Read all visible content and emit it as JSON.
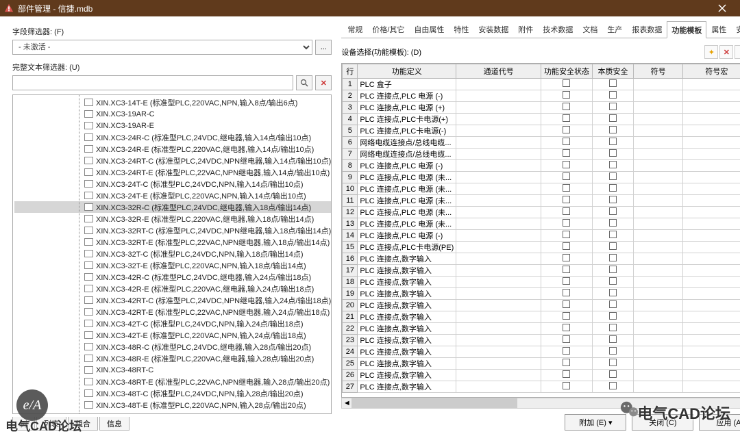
{
  "window": {
    "title": "部件管理 - 信捷.mdb"
  },
  "left": {
    "field_filter_label": "字段筛选器: (F)",
    "field_filter_value": "- 未激活 -",
    "text_filter_label": "完整文本筛选器: (U)",
    "text_filter_value": "",
    "tree_selected": 11,
    "tree_items": [
      "XIN.XC3-14T-E (标准型PLC,220VAC,NPN,输入8点/输出6点)",
      "XIN.XC3-19AR-C",
      "XIN.XC3-19AR-E",
      "XIN.XC3-24R-C (标准型PLC,24VDC,继电器,输入14点/输出10点)",
      "XIN.XC3-24R-E (标准型PLC,220VAC,继电器,输入14点/输出10点)",
      "XIN.XC3-24RT-C (标准型PLC,24VDC,NPN继电器,输入14点/输出10点)",
      "XIN.XC3-24RT-E (标准型PLC,22VAC,NPN继电器,输入14点/输出10点)",
      "XIN.XC3-24T-C (标准型PLC,24VDC,NPN,输入14点/输出10点)",
      "XIN.XC3-24T-E (标准型PLC,220VAC,NPN,输入14点/输出10点)",
      "XIN.XC3-32R-C (标准型PLC,24VDC,继电器,输入18点/输出14点)",
      "XIN.XC3-32R-E (标准型PLC,220VAC,继电器,输入18点/输出14点)",
      "XIN.XC3-32RT-C (标准型PLC,24VDC,NPN继电器,输入18点/输出14点)",
      "XIN.XC3-32RT-E (标准型PLC,22VAC,NPN继电器,输入18点/输出14点)",
      "XIN.XC3-32T-C (标准型PLC,24VDC,NPN,输入18点/输出14点)",
      "XIN.XC3-32T-E (标准型PLC,220VAC,NPN,输入18点/输出14点)",
      "XIN.XC3-42R-C (标准型PLC,24VDC,继电器,输入24点/输出18点)",
      "XIN.XC3-42R-E (标准型PLC,220VAC,继电器,输入24点/输出18点)",
      "XIN.XC3-42RT-C (标准型PLC,24VDC,NPN继电器,输入24点/输出18点)",
      "XIN.XC3-42RT-E (标准型PLC,22VAC,NPN继电器,输入24点/输出18点)",
      "XIN.XC3-42T-C (标准型PLC,24VDC,NPN,输入24点/输出18点)",
      "XIN.XC3-42T-E (标准型PLC,220VAC,NPN,输入24点/输出18点)",
      "XIN.XC3-48R-C (标准型PLC,24VDC,继电器,输入28点/输出20点)",
      "XIN.XC3-48R-E (标准型PLC,220VAC,继电器,输入28点/输出20点)",
      "XIN.XC3-48RT-C",
      "XIN.XC3-48RT-E (标准型PLC,22VAC,NPN继电器,输入28点/输出20点)",
      "XIN.XC3-48T-C (标准型PLC,24VDC,NPN,输入28点/输出20点)",
      "XIN.XC3-48T-E (标准型PLC,220VAC,NPN,输入28点/输出20点)"
    ],
    "tabs": [
      "树",
      "列表",
      "组合",
      "信息"
    ]
  },
  "right": {
    "tabs": [
      "常规",
      "价格/其它",
      "自由属性",
      "特性",
      "安装数据",
      "附件",
      "技术数据",
      "文档",
      "生产",
      "报表数据",
      "功能模板",
      "属性",
      "安全值"
    ],
    "tabs_active": 10,
    "device_sel_label": "设备选择(功能模板): (D)",
    "columns": [
      "行",
      "功能定义",
      "通道代号",
      "功能安全状态",
      "本质安全",
      "符号",
      "符号宏"
    ],
    "rows": [
      {
        "n": 1,
        "def": "PLC 盒子"
      },
      {
        "n": 2,
        "def": "PLC 连接点,PLC 电源 (-)"
      },
      {
        "n": 3,
        "def": "PLC 连接点,PLC 电源 (+)"
      },
      {
        "n": 4,
        "def": "PLC 连接点,PLC卡电源(+)"
      },
      {
        "n": 5,
        "def": "PLC 连接点,PLC卡电源(-)"
      },
      {
        "n": 6,
        "def": "网络电缆连接点/总线电缆..."
      },
      {
        "n": 7,
        "def": "网络电缆连接点/总线电缆..."
      },
      {
        "n": 8,
        "def": "PLC 连接点,PLC 电源 (-)"
      },
      {
        "n": 9,
        "def": "PLC 连接点,PLC 电源 (未..."
      },
      {
        "n": 10,
        "def": "PLC 连接点,PLC 电源 (未..."
      },
      {
        "n": 11,
        "def": "PLC 连接点,PLC 电源 (未..."
      },
      {
        "n": 12,
        "def": "PLC 连接点,PLC 电源 (未..."
      },
      {
        "n": 13,
        "def": "PLC 连接点,PLC 电源 (未..."
      },
      {
        "n": 14,
        "def": "PLC 连接点,PLC 电源 (-)"
      },
      {
        "n": 15,
        "def": "PLC 连接点,PLC卡电源(PE)"
      },
      {
        "n": 16,
        "def": "PLC 连接点,数字输入"
      },
      {
        "n": 17,
        "def": "PLC 连接点,数字输入"
      },
      {
        "n": 18,
        "def": "PLC 连接点,数字输入"
      },
      {
        "n": 19,
        "def": "PLC 连接点,数字输入"
      },
      {
        "n": 20,
        "def": "PLC 连接点,数字输入"
      },
      {
        "n": 21,
        "def": "PLC 连接点,数字输入"
      },
      {
        "n": 22,
        "def": "PLC 连接点,数字输入"
      },
      {
        "n": 23,
        "def": "PLC 连接点,数字输入"
      },
      {
        "n": 24,
        "def": "PLC 连接点,数字输入"
      },
      {
        "n": 25,
        "def": "PLC 连接点,数字输入"
      },
      {
        "n": 26,
        "def": "PLC 连接点,数字输入"
      },
      {
        "n": 27,
        "def": "PLC 连接点,数字输入"
      }
    ]
  },
  "buttons": {
    "extras": "附加 (E)",
    "close": "关闭 (C)",
    "apply": "应用 (A)"
  },
  "overlay": {
    "logo": "e/A",
    "text1": "电气CAD论坛",
    "text2": "电气CAD论坛"
  }
}
